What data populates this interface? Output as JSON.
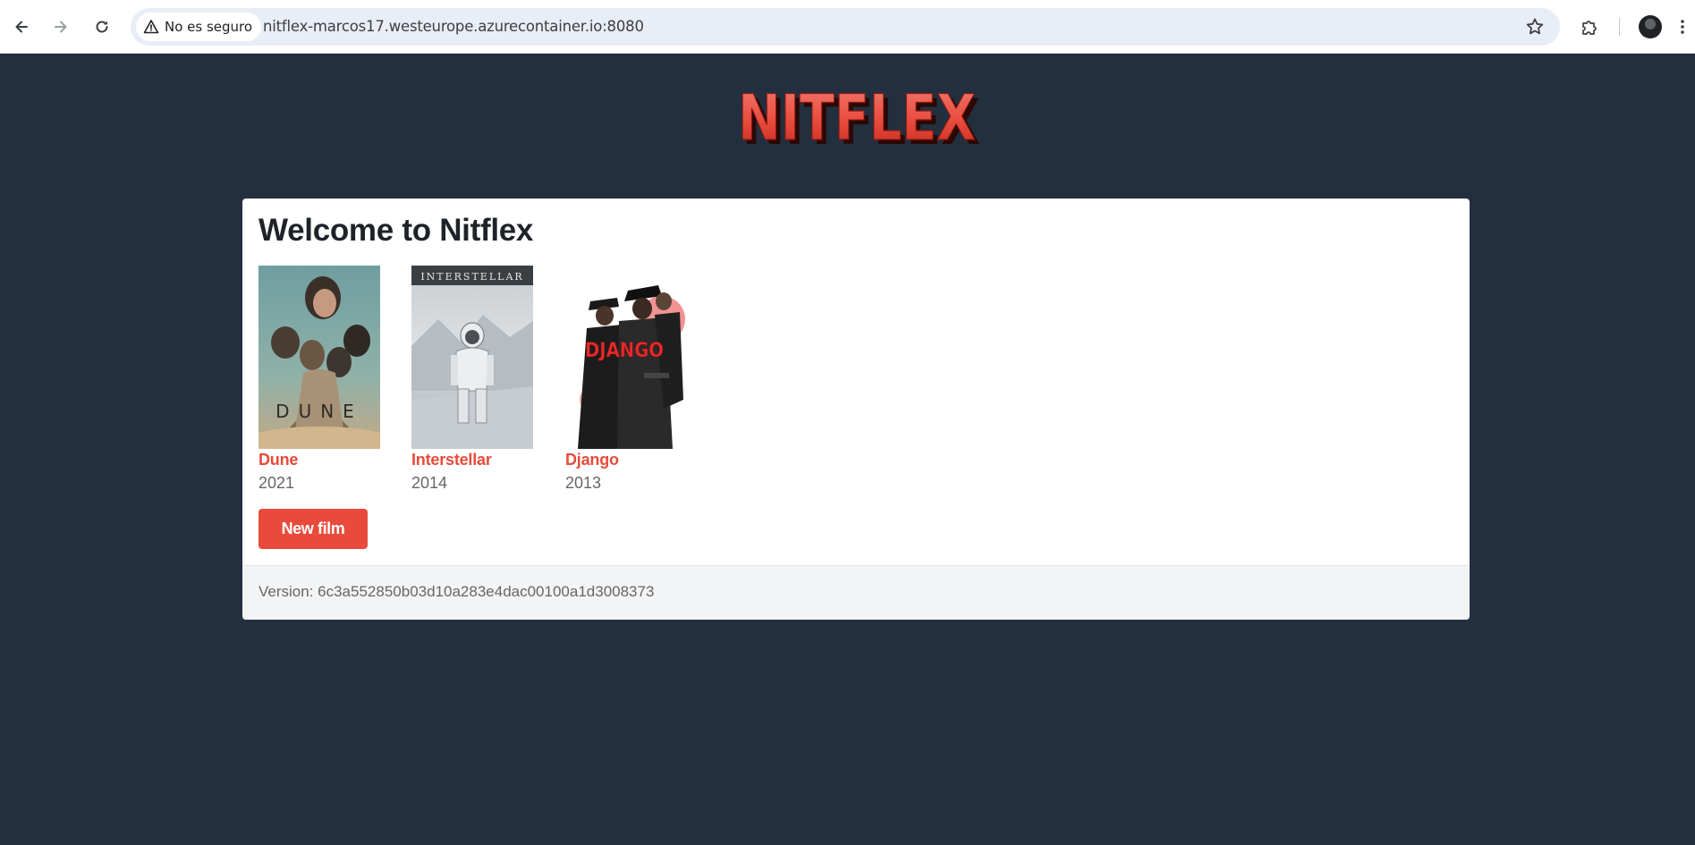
{
  "browser": {
    "security_label": "No es seguro",
    "url": "nitflex-marcos17.westeurope.azurecontainer.io:8080"
  },
  "brand": {
    "logo_text": "NITFLEX",
    "accent_color": "#e84b3c",
    "background_color": "#222f3e"
  },
  "main": {
    "title": "Welcome to Nitflex",
    "films": [
      {
        "title": "Dune",
        "year": "2021",
        "poster_text": "DUNE"
      },
      {
        "title": "Interstellar",
        "year": "2014",
        "poster_text": "INTERSTELLAR"
      },
      {
        "title": "Django",
        "year": "2013",
        "poster_text": "DJANGO"
      }
    ],
    "new_film_label": "New film"
  },
  "footer": {
    "version": "Version: 6c3a552850b03d10a283e4dac00100a1d3008373"
  }
}
